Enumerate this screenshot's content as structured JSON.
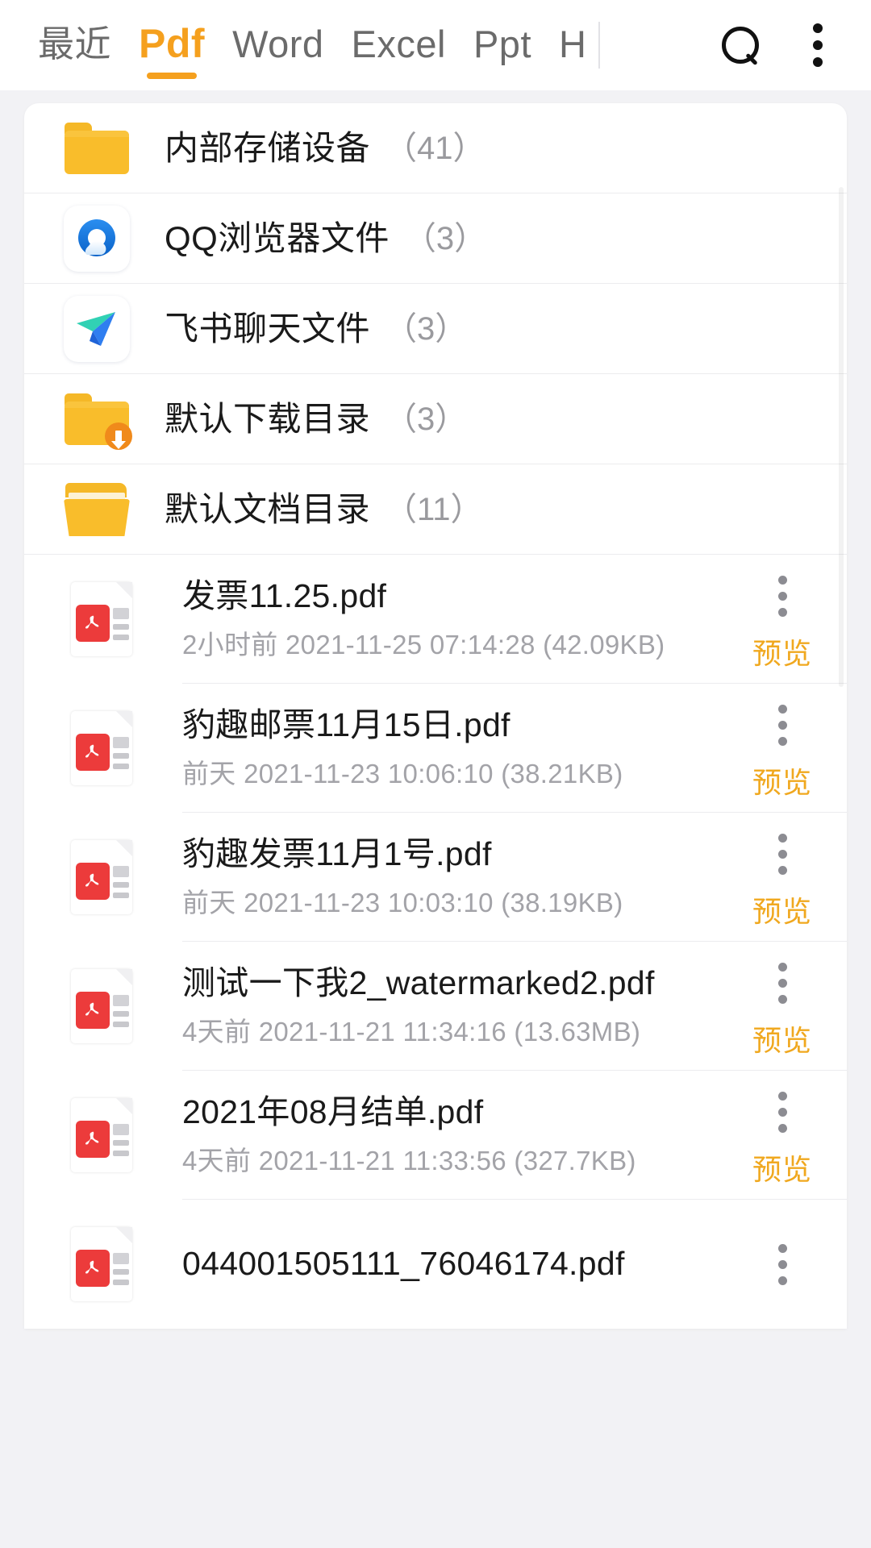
{
  "topbar": {
    "tabs": [
      {
        "label": "最近",
        "active": false,
        "cjk": true
      },
      {
        "label": "Pdf",
        "active": true,
        "cjk": false
      },
      {
        "label": "Word",
        "active": false,
        "cjk": false
      },
      {
        "label": "Excel",
        "active": false,
        "cjk": false
      },
      {
        "label": "Ppt",
        "active": false,
        "cjk": false
      },
      {
        "label": "H",
        "active": false,
        "cjk": false
      }
    ],
    "search_icon": "search-icon",
    "overflow_icon": "more-vertical-icon",
    "accent_color": "#f5a01e"
  },
  "folders": [
    {
      "name": "内部存储设备",
      "count": "（41）",
      "icon": "folder-icon"
    },
    {
      "name": "QQ浏览器文件",
      "count": "（3）",
      "icon": "qq-browser-icon"
    },
    {
      "name": "飞书聊天文件",
      "count": "（3）",
      "icon": "feishu-icon"
    },
    {
      "name": "默认下载目录",
      "count": "（3）",
      "icon": "folder-download-icon"
    },
    {
      "name": "默认文档目录",
      "count": "（11）",
      "icon": "folder-open-icon"
    }
  ],
  "files": [
    {
      "name": "发票11.25.pdf",
      "meta": "2小时前 2021-11-25 07:14:28 (42.09KB)",
      "relative_time": "2小时前",
      "date": "2021-11-25",
      "time": "07:14:28",
      "size": "42.09KB",
      "icon": "pdf-file-icon",
      "preview_label": "预览"
    },
    {
      "name": "豹趣邮票11月15日.pdf",
      "meta": "前天 2021-11-23 10:06:10 (38.21KB)",
      "relative_time": "前天",
      "date": "2021-11-23",
      "time": "10:06:10",
      "size": "38.21KB",
      "icon": "pdf-file-icon",
      "preview_label": "预览"
    },
    {
      "name": "豹趣发票11月1号.pdf",
      "meta": "前天 2021-11-23 10:03:10 (38.19KB)",
      "relative_time": "前天",
      "date": "2021-11-23",
      "time": "10:03:10",
      "size": "38.19KB",
      "icon": "pdf-file-icon",
      "preview_label": "预览"
    },
    {
      "name": "测试一下我2_watermarked2.pdf",
      "meta": "4天前 2021-11-21 11:34:16 (13.63MB)",
      "relative_time": "4天前",
      "date": "2021-11-21",
      "time": "11:34:16",
      "size": "13.63MB",
      "icon": "pdf-file-icon",
      "preview_label": "预览"
    },
    {
      "name": "2021年08月结单.pdf",
      "meta": "4天前 2021-11-21 11:33:56 (327.7KB)",
      "relative_time": "4天前",
      "date": "2021-11-21",
      "time": "11:33:56",
      "size": "327.7KB",
      "icon": "pdf-file-icon",
      "preview_label": "预览"
    },
    {
      "name": "044001505111_76046174.pdf",
      "meta": "",
      "relative_time": "",
      "date": "",
      "time": "",
      "size": "",
      "icon": "pdf-file-icon",
      "preview_label": ""
    }
  ]
}
